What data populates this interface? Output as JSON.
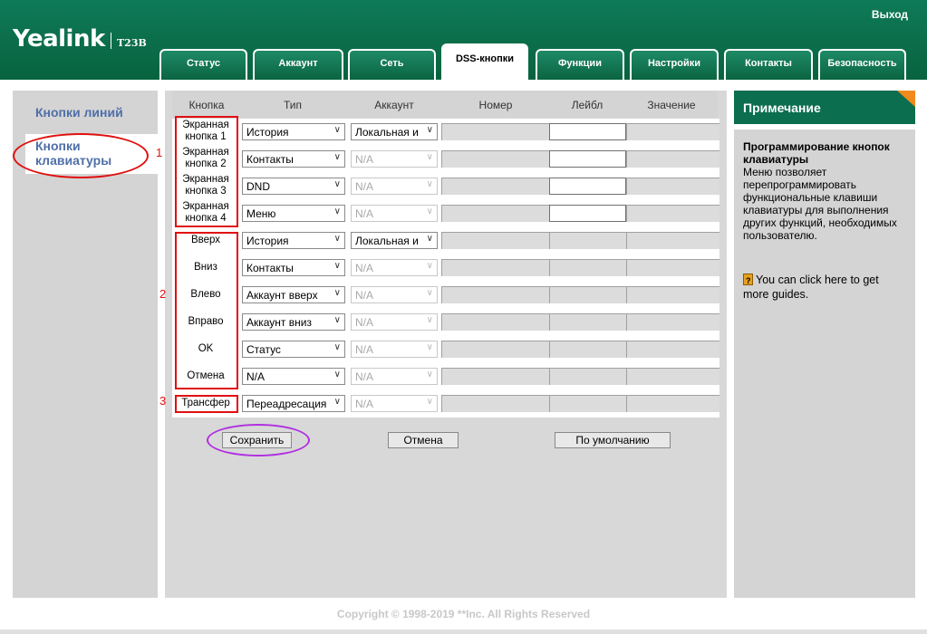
{
  "header": {
    "logo": "Yealink",
    "model": "T23B",
    "logout": "Выход",
    "tabs": [
      "Статус",
      "Аккаунт",
      "Сеть",
      "DSS-кнопки",
      "Функции",
      "Настройки",
      "Контакты",
      "Безопасность"
    ],
    "active_tab": "DSS-кнопки"
  },
  "sidebar": {
    "items": [
      {
        "label": "Кнопки линий"
      },
      {
        "label_line1": "Кнопки",
        "label_line2": "клавиатуры"
      }
    ]
  },
  "table": {
    "columns": [
      "Кнопка",
      "Тип",
      "Аккаунт",
      "Номер",
      "Лейбл",
      "Значение"
    ],
    "rows": [
      {
        "key_line1": "Экранная",
        "key_line2": "кнопка 1",
        "type": "История",
        "account": "Локальная и",
        "label_editable": true
      },
      {
        "key_line1": "Экранная",
        "key_line2": "кнопка 2",
        "type": "Контакты",
        "account": "N/A",
        "label_editable": true
      },
      {
        "key_line1": "Экранная",
        "key_line2": "кнопка 3",
        "type": "DND",
        "account": "N/A",
        "label_editable": true
      },
      {
        "key_line1": "Экранная",
        "key_line2": "кнопка 4",
        "type": "Меню",
        "account": "N/A",
        "label_editable": true
      },
      {
        "key_line1": "Вверх",
        "key_line2": "",
        "type": "История",
        "account": "Локальная и",
        "label_editable": false
      },
      {
        "key_line1": "Вниз",
        "key_line2": "",
        "type": "Контакты",
        "account": "N/A",
        "label_editable": false
      },
      {
        "key_line1": "Влево",
        "key_line2": "",
        "type": "Аккаунт вверх",
        "account": "N/A",
        "label_editable": false
      },
      {
        "key_line1": "Вправо",
        "key_line2": "",
        "type": "Аккаунт вниз",
        "account": "N/A",
        "label_editable": false
      },
      {
        "key_line1": "OK",
        "key_line2": "",
        "type": "Статус",
        "account": "N/A",
        "label_editable": false
      },
      {
        "key_line1": "Отмена",
        "key_line2": "",
        "type": "N/A",
        "account": "N/A",
        "label_editable": false
      },
      {
        "key_line1": "Трансфер",
        "key_line2": "",
        "type": "Переадресация",
        "account": "N/A",
        "label_editable": false
      }
    ]
  },
  "annotations": [
    "1",
    "2",
    "3"
  ],
  "buttons": {
    "save": "Сохранить",
    "cancel": "Отмена",
    "default": "По умолчанию"
  },
  "note": {
    "header": "Примечание",
    "title": "Программирование кнопок клавиатуры",
    "body": "Меню позволяет перепрограммировать функциональные клавиши клавиатуры для выполнения других функций, необходимых пользователю.",
    "guide": "You can click here to get more guides."
  },
  "footer": "Copyright © 1998-2019 **Inc. All Rights Reserved",
  "colors": {
    "brand_green": "#0b6e4f",
    "link_blue": "#4f6fa8",
    "annotation_red": "#e01010",
    "annotation_purple": "#b030e0",
    "note_corner_orange": "#f08a1c"
  }
}
